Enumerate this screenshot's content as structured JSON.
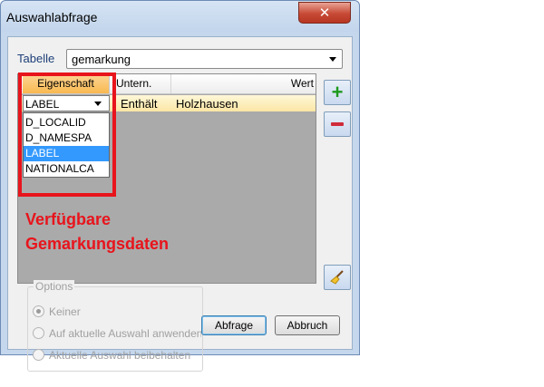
{
  "window": {
    "title": "Auswahlabfrage",
    "close_label": "✕"
  },
  "table_selector": {
    "label": "Tabelle",
    "value": "gemarkung"
  },
  "grid": {
    "headers": {
      "property": "Eigenschaft",
      "operator": "Untern.",
      "value": "Wert"
    },
    "row": {
      "property": "LABEL",
      "operator": "Enthält",
      "value": "Holzhausen"
    },
    "dropdown_options": [
      "D_LOCALID",
      "D_NAMESPA",
      "LABEL",
      "NATIONALCA"
    ],
    "selected_option": "LABEL"
  },
  "annotation": {
    "line1": "Verfügbare",
    "line2": "Gemarkungsdaten",
    "color": "#e8141c"
  },
  "options": {
    "legend": "Options",
    "radios": [
      {
        "label": "Keiner",
        "checked": true
      },
      {
        "label": "Auf aktuelle Auswahl anwenden",
        "checked": false
      },
      {
        "label": "Aktuelle Auswahl beibehalten",
        "checked": false
      }
    ]
  },
  "buttons": {
    "query": "Abfrage",
    "cancel": "Abbruch"
  },
  "icons": {
    "add": "plus-icon",
    "remove": "minus-icon",
    "clear": "broom-icon"
  }
}
